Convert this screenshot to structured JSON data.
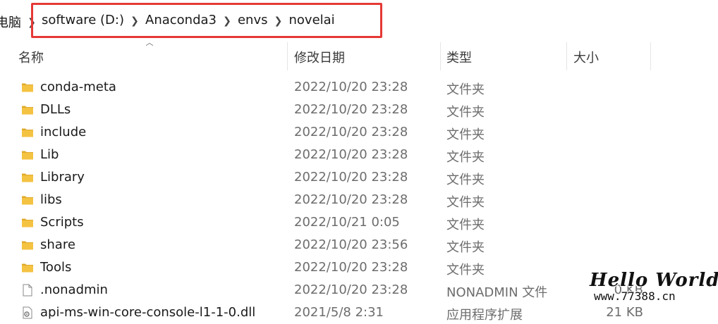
{
  "addressbar": {
    "root_label": "电脑",
    "crumbs": [
      {
        "label": "software (D:)"
      },
      {
        "label": "Anaconda3"
      },
      {
        "label": "envs"
      },
      {
        "label": "novelai"
      }
    ],
    "highlight_color": "#e53935"
  },
  "columns": {
    "name": "名称",
    "date": "修改日期",
    "type": "类型",
    "size": "大小"
  },
  "files": [
    {
      "name": "conda-meta",
      "date": "2022/10/20 23:28",
      "type": "文件夹",
      "size": "",
      "icon": "folder-icon"
    },
    {
      "name": "DLLs",
      "date": "2022/10/20 23:28",
      "type": "文件夹",
      "size": "",
      "icon": "folder-icon"
    },
    {
      "name": "include",
      "date": "2022/10/20 23:28",
      "type": "文件夹",
      "size": "",
      "icon": "folder-icon"
    },
    {
      "name": "Lib",
      "date": "2022/10/20 23:28",
      "type": "文件夹",
      "size": "",
      "icon": "folder-icon"
    },
    {
      "name": "Library",
      "date": "2022/10/20 23:28",
      "type": "文件夹",
      "size": "",
      "icon": "folder-icon"
    },
    {
      "name": "libs",
      "date": "2022/10/20 23:28",
      "type": "文件夹",
      "size": "",
      "icon": "folder-icon"
    },
    {
      "name": "Scripts",
      "date": "2022/10/21 0:05",
      "type": "文件夹",
      "size": "",
      "icon": "folder-icon"
    },
    {
      "name": "share",
      "date": "2022/10/20 23:56",
      "type": "文件夹",
      "size": "",
      "icon": "folder-icon"
    },
    {
      "name": "Tools",
      "date": "2022/10/20 23:28",
      "type": "文件夹",
      "size": "",
      "icon": "folder-icon"
    },
    {
      "name": ".nonadmin",
      "date": "2022/10/20 23:28",
      "type": "NONADMIN 文件",
      "size": "0 KB",
      "icon": "file-icon"
    },
    {
      "name": "api-ms-win-core-console-l1-1-0.dll",
      "date": "2021/5/8 2:31",
      "type": "应用程序扩展",
      "size": "21 KB",
      "icon": "dll-file-icon"
    }
  ],
  "watermark": {
    "title": "Hello World",
    "site": "www.77388.cn"
  },
  "colors": {
    "folder": "#f4c342",
    "folder_dark": "#e0a92a",
    "secondary_text": "#6d6d6d"
  }
}
